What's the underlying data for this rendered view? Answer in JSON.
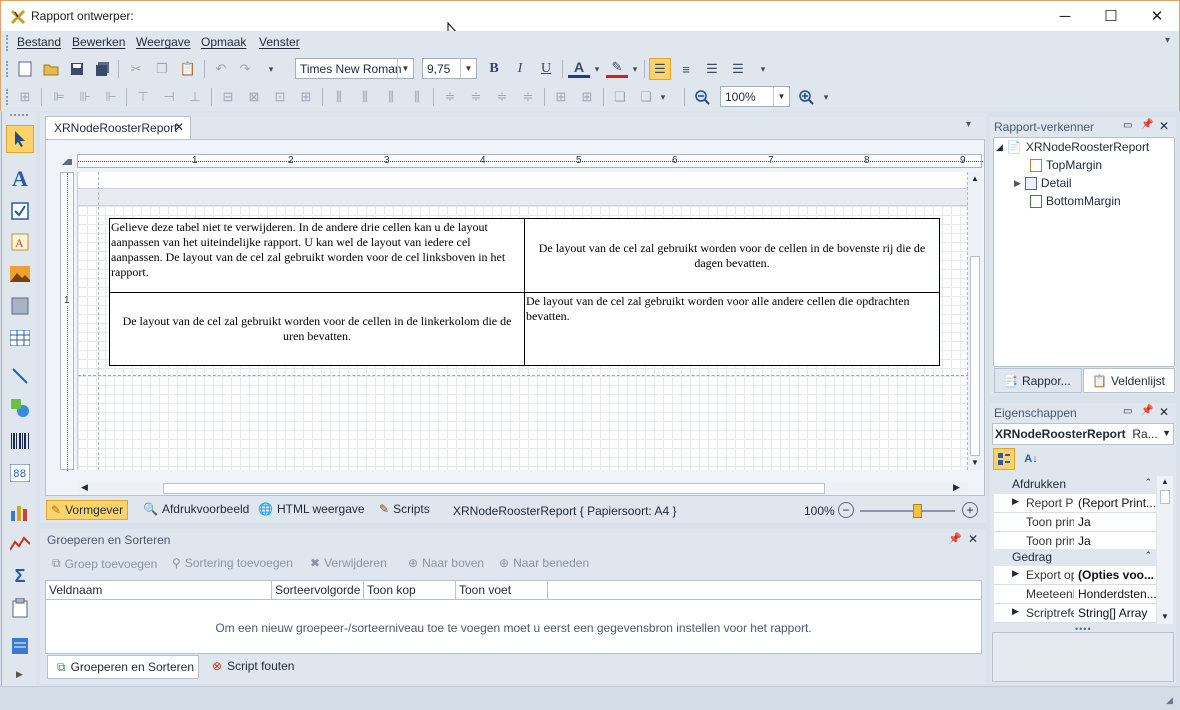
{
  "window": {
    "title": "Rapport ontwerper:",
    "controls": {
      "minimize": "─",
      "maximize": "☐",
      "close": "✕"
    }
  },
  "menu": [
    "Bestand",
    "Bewerken",
    "Weergave",
    "Opmaak",
    "Venster"
  ],
  "toolbar": {
    "font_name": "Times New Roman",
    "font_size": "9,75",
    "bold": "B",
    "italic": "I",
    "underline": "U",
    "zoom": "100%"
  },
  "document": {
    "tab_label": "XRNodeRoosterReport",
    "cells": {
      "top_left": "Gelieve deze tabel niet te verwijderen. In de andere drie cellen kan u de layout aanpassen van het uiteindelijke rapport. U kan wel de layout van iedere cel aanpassen. De layout van de cel zal gebruikt worden voor de cel linksboven in het rapport.",
      "top_right": "De layout van de cel zal gebruikt worden voor de cellen in de bovenste rij die de dagen bevatten.",
      "bottom_left": "De layout van de cel zal gebruikt worden voor de cellen in de linkerkolom die de uren bevatten.",
      "bottom_right": "De layout van de cel zal gebruikt worden voor alle andere cellen die opdrachten bevatten."
    },
    "ruler_numbers": [
      "1",
      "2",
      "3",
      "4",
      "5",
      "6",
      "7",
      "8",
      "9"
    ],
    "vruler_numbers": [
      "1"
    ]
  },
  "designer_bar": {
    "vormgever": "Vormgever",
    "preview": "Afdrukvoorbeeld",
    "html": "HTML weergave",
    "scripts": "Scripts",
    "status": "XRNodeRoosterReport { Papiersoort: A4 }",
    "zoom": "100%",
    "zoom_level": 0.6
  },
  "group_sort": {
    "title": "Groeperen en Sorteren",
    "actions": [
      "Groep toevoegen",
      "Sortering toevoegen",
      "Verwijderen",
      "Naar boven",
      "Naar beneden"
    ],
    "columns": [
      "Veldnaam",
      "Sorteervolgorde",
      "Toon kop",
      "Toon voet"
    ],
    "empty_message": "Om een nieuw groepeer-/sorteerniveau toe te voegen moet u eerst een gegevensbron instellen voor het rapport.",
    "tabs": [
      "Groeperen en Sorteren",
      "Script fouten"
    ]
  },
  "explorer": {
    "title": "Rapport-verkenner",
    "root": "XRNodeRoosterReport",
    "items": [
      "TopMargin",
      "Detail",
      "BottomMargin"
    ],
    "tabs": [
      "Rappor...",
      "Veldenlijst"
    ]
  },
  "properties": {
    "title": "Eigenschappen",
    "selected": "XRNodeRoosterReport",
    "selected_suffix": "Ra...",
    "categories": [
      {
        "name": "Afdrukken",
        "rows": [
          {
            "name": "Report Pr",
            "value": "(Report Print..."
          },
          {
            "name": "Toon prin",
            "value": "Ja"
          },
          {
            "name": "Toon prin",
            "value": "Ja"
          }
        ]
      },
      {
        "name": "Gedrag",
        "rows": [
          {
            "name": "Export op",
            "value": "(Opties voo..."
          },
          {
            "name": "Meeteenh",
            "value": "Honderdsten..."
          },
          {
            "name": "Scriptrefe",
            "value": "String[] Array"
          }
        ]
      }
    ]
  }
}
